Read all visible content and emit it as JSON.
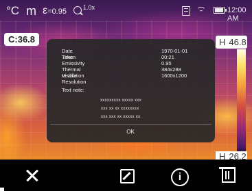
{
  "status_bar": {
    "unit": "°C",
    "mode": "m",
    "emissivity_symbol": "ε",
    "emissivity": "=0.95",
    "zoom": "1.0x",
    "time": "12:00 AM",
    "icons": [
      "sd-card-icon",
      "wifi-icon",
      "battery-icon"
    ]
  },
  "overlay": {
    "center_temp": "C:36.8",
    "high_label": "H",
    "high_value": "46.8",
    "low_label": "H",
    "low_value": "26.2"
  },
  "dialog": {
    "rows": [
      {
        "label": "Date Taken",
        "value": "1970-01-01"
      },
      {
        "label": "Time",
        "value": "00:21"
      },
      {
        "label": "Emissivity",
        "value": "0.95"
      },
      {
        "label": "Thermal resolution",
        "value": "384x288"
      },
      {
        "label": "Visible Resolution",
        "value": "1600x1200"
      }
    ],
    "text_note_label": "Text note:",
    "note_lines": [
      "xxxxxxxxx xxxxx xxx",
      "xxx xx  xx xxxxxxxx",
      "xxx xxx xx xxxxx xx"
    ],
    "ok_label": "OK"
  },
  "toolbar": {
    "buttons": [
      "close-icon",
      "edit-icon",
      "info-icon",
      "delete-icon"
    ]
  }
}
